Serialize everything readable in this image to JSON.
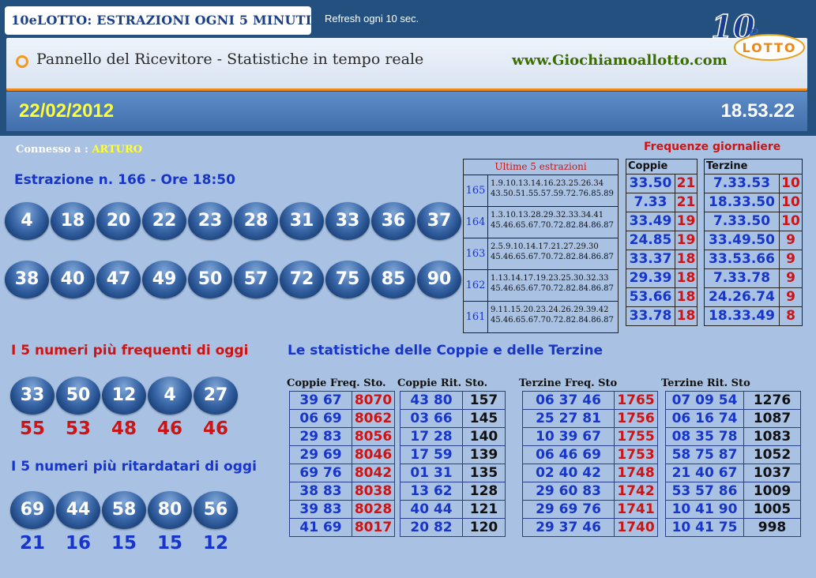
{
  "header": {
    "title": "10eLOTTO: ESTRAZIONI OGNI 5 MINUTI",
    "refresh": "Refresh ogni 10 sec.",
    "panel_title": "Pannello del Ricevitore - Statistiche in tempo reale",
    "site_url": "www.Giochiamoallotto.com",
    "logo_top": "10",
    "logo_e": "e",
    "logo_word": "LOTTO",
    "date": "22/02/2012",
    "time": "18.53.22"
  },
  "connection": {
    "label": "Connesso a :",
    "user": "ARTURO"
  },
  "draw": {
    "title": "Estrazione n. 166 - Ore 18:50",
    "row1": [
      "4",
      "18",
      "20",
      "22",
      "23",
      "28",
      "31",
      "33",
      "36",
      "37"
    ],
    "row2": [
      "38",
      "40",
      "47",
      "49",
      "50",
      "57",
      "72",
      "75",
      "85",
      "90"
    ]
  },
  "last5": {
    "title": "Ultime 5 estrazioni",
    "rows": [
      {
        "n": "165",
        "l1": "1.9.10.13.14.16.23.25.26.34",
        "l2": "43.50.51.55.57.59.72.76.85.89"
      },
      {
        "n": "164",
        "l1": "1.3.10.13.28.29.32.33.34.41",
        "l2": "45.46.65.67.70.72.82.84.86.87"
      },
      {
        "n": "163",
        "l1": "2.5.9.10.14.17.21.27.29.30",
        "l2": "45.46.65.67.70.72.82.84.86.87"
      },
      {
        "n": "162",
        "l1": "1.13.14.17.19.23.25.30.32.33",
        "l2": "45.46.65.67.70.72.82.84.86.87"
      },
      {
        "n": "161",
        "l1": "9.11.15.20.23.24.26.29.39.42",
        "l2": "45.46.65.67.70.72.82.84.86.87"
      }
    ]
  },
  "daily": {
    "title": "Frequenze giornaliere",
    "coppie_label": "Coppie",
    "terzine_label": "Terzine",
    "coppie": [
      [
        "33.50",
        "21"
      ],
      [
        "7.33",
        "21"
      ],
      [
        "33.49",
        "19"
      ],
      [
        "24.85",
        "19"
      ],
      [
        "33.37",
        "18"
      ],
      [
        "29.39",
        "18"
      ],
      [
        "53.66",
        "18"
      ],
      [
        "33.78",
        "18"
      ]
    ],
    "terzine": [
      [
        "7.33.53",
        "10"
      ],
      [
        "18.33.50",
        "10"
      ],
      [
        "7.33.50",
        "10"
      ],
      [
        "33.49.50",
        "9"
      ],
      [
        "33.53.66",
        "9"
      ],
      [
        "7.33.78",
        "9"
      ],
      [
        "24.26.74",
        "9"
      ],
      [
        "18.33.49",
        "8"
      ]
    ]
  },
  "frequent": {
    "title": "I 5 numeri più frequenti di oggi",
    "numbers": [
      "33",
      "50",
      "12",
      "4",
      "27"
    ],
    "counts": [
      "55",
      "53",
      "48",
      "46",
      "46"
    ]
  },
  "late": {
    "title": "I 5 numeri più ritardatari di oggi",
    "numbers": [
      "69",
      "44",
      "58",
      "80",
      "56"
    ],
    "counts": [
      "21",
      "16",
      "15",
      "15",
      "12"
    ]
  },
  "stats": {
    "title": "Le statistiche delle Coppie e delle Terzine",
    "coppie_freq": {
      "label": "Coppie Freq. Sto.",
      "rows": [
        [
          "39 67",
          "8070"
        ],
        [
          "06 69",
          "8062"
        ],
        [
          "29 83",
          "8056"
        ],
        [
          "29 69",
          "8046"
        ],
        [
          "69 76",
          "8042"
        ],
        [
          "38 83",
          "8038"
        ],
        [
          "39 83",
          "8028"
        ],
        [
          "41 69",
          "8017"
        ]
      ]
    },
    "coppie_rit": {
      "label": "Coppie Rit. Sto.",
      "rows": [
        [
          "43 80",
          "157"
        ],
        [
          "03 66",
          "145"
        ],
        [
          "17 28",
          "140"
        ],
        [
          "17 59",
          "139"
        ],
        [
          "01 31",
          "135"
        ],
        [
          "13 62",
          "128"
        ],
        [
          "40 44",
          "121"
        ],
        [
          "20 82",
          "120"
        ]
      ]
    },
    "terzine_freq": {
      "label": "Terzine Freq. Sto",
      "rows": [
        [
          "06 37 46",
          "1765"
        ],
        [
          "25 27 81",
          "1756"
        ],
        [
          "10 39 67",
          "1755"
        ],
        [
          "06 46 69",
          "1753"
        ],
        [
          "02 40 42",
          "1748"
        ],
        [
          "29 60 83",
          "1742"
        ],
        [
          "29 69 76",
          "1741"
        ],
        [
          "29 37 46",
          "1740"
        ]
      ]
    },
    "terzine_rit": {
      "label": "Terzine Rit. Sto",
      "rows": [
        [
          "07 09 54",
          "1276"
        ],
        [
          "06 16 74",
          "1087"
        ],
        [
          "08 35 78",
          "1083"
        ],
        [
          "58 75 87",
          "1052"
        ],
        [
          "21 40 67",
          "1037"
        ],
        [
          "53 57 86",
          "1009"
        ],
        [
          "10 41 90",
          "1005"
        ],
        [
          "10 41 75",
          "998"
        ]
      ]
    }
  }
}
